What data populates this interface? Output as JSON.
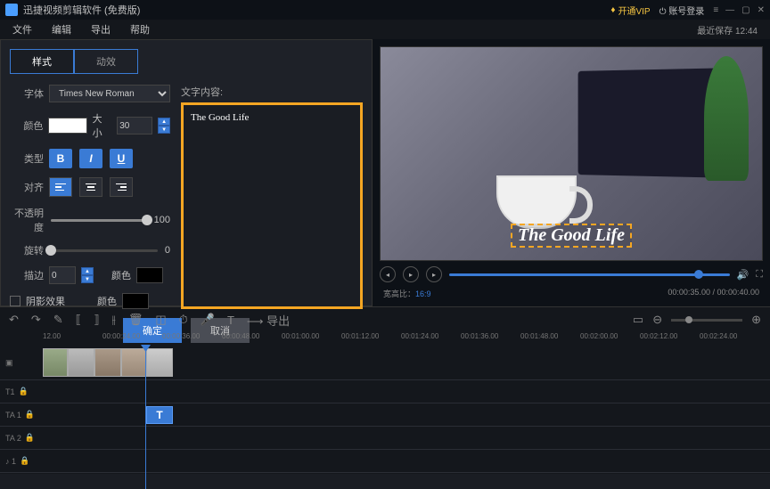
{
  "titlebar": {
    "app": "迅捷视频剪辑软件 (免费版)",
    "vip": "开通VIP",
    "login": "账号登录"
  },
  "menu": {
    "file": "文件",
    "edit": "编辑",
    "export": "导出",
    "help": "帮助",
    "autosave": "最近保存 12:44"
  },
  "tabs": {
    "style": "样式",
    "motion": "动效"
  },
  "props": {
    "font_label": "字体",
    "font_value": "Times New Roman",
    "color_label": "颜色",
    "size_label": "大小",
    "size_value": "30",
    "type_label": "类型",
    "bold": "B",
    "italic": "I",
    "underline": "U",
    "align_label": "对齐",
    "opacity_label": "不透明度",
    "opacity_value": "100",
    "rotate_label": "旋转",
    "rotate_value": "0",
    "stroke_label": "描边",
    "stroke_value": "0",
    "stroke_color_label": "颜色",
    "shadow_label": "阴影效果",
    "shadow_color_label": "颜色"
  },
  "textarea": {
    "label": "文字内容:",
    "value": "The Good Life"
  },
  "buttons": {
    "ok": "确定",
    "cancel": "取消"
  },
  "preview": {
    "overlay": "The Good Life",
    "ratio_label": "宽高比：",
    "ratio": "16:9",
    "time": "00:00:35.00 / 00:00:40.00"
  },
  "toolbar": {
    "export": "导出"
  },
  "ruler": [
    "12.00",
    "00:00:24.00",
    "00:00:36.00",
    "00:00:48.00",
    "00:01:00.00",
    "00:01:12.00",
    "00:01:24.00",
    "00:01:36.00",
    "00:01:48.00",
    "00:02:00.00",
    "00:02:12.00",
    "00:02:24.00"
  ],
  "tracks": {
    "t1": "T1",
    "ta1": "TA 1",
    "ta2": "TA 2",
    "m1": "♪ 1"
  }
}
